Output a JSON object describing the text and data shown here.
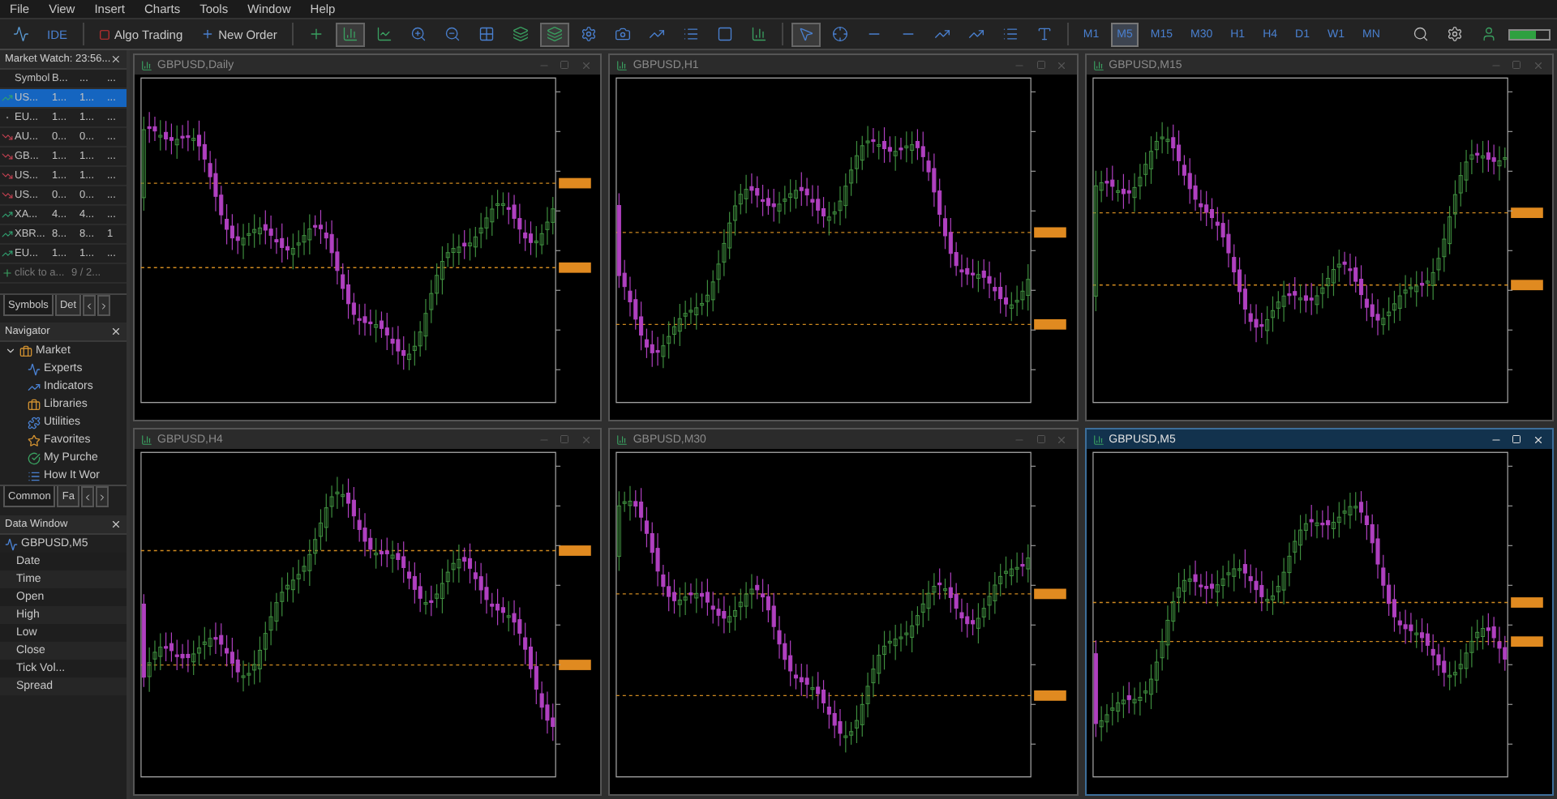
{
  "menu": [
    "File",
    "View",
    "Insert",
    "Charts",
    "Tools",
    "Window",
    "Help"
  ],
  "toolbar": {
    "ide": "IDE",
    "algo_trading": "Algo Trading",
    "new_order": "New Order",
    "timeframes": [
      {
        "label": "M1",
        "selected": false
      },
      {
        "label": "M5",
        "selected": true
      },
      {
        "label": "M15",
        "selected": false
      },
      {
        "label": "M30",
        "selected": false
      },
      {
        "label": "H1",
        "selected": false
      },
      {
        "label": "H4",
        "selected": false
      },
      {
        "label": "D1",
        "selected": false
      },
      {
        "label": "W1",
        "selected": false
      },
      {
        "label": "MN",
        "selected": false
      }
    ]
  },
  "market_watch": {
    "title": "Market Watch: 23:56...",
    "columns": [
      "Symbol",
      "B...",
      "...",
      "..."
    ],
    "rows": [
      {
        "kind": "up",
        "cells": [
          "US...",
          "1...",
          "1...",
          "..."
        ],
        "selected": true
      },
      {
        "kind": "flat",
        "cells": [
          "EU...",
          "1...",
          "1...",
          "..."
        ],
        "selected": false
      },
      {
        "kind": "down",
        "cells": [
          "AU...",
          "0...",
          "0...",
          "..."
        ],
        "selected": false
      },
      {
        "kind": "down",
        "cells": [
          "GB...",
          "1...",
          "1...",
          "..."
        ],
        "selected": false
      },
      {
        "kind": "down",
        "cells": [
          "US...",
          "1...",
          "1...",
          "..."
        ],
        "selected": false
      },
      {
        "kind": "down",
        "cells": [
          "US...",
          "0...",
          "0...",
          "..."
        ],
        "selected": false
      },
      {
        "kind": "up",
        "cells": [
          "XA...",
          "4...",
          "4...",
          "..."
        ],
        "selected": false
      },
      {
        "kind": "up",
        "cells": [
          "XBR...",
          "8...",
          "8...",
          "1"
        ],
        "selected": false
      },
      {
        "kind": "up",
        "cells": [
          "EU...",
          "1...",
          "1...",
          "..."
        ],
        "selected": false
      }
    ],
    "add_row": {
      "label": "click to a...",
      "count": "9 / 2..."
    },
    "tabs": [
      {
        "label": "Symbols",
        "selected": true
      },
      {
        "label": "Det",
        "selected": false
      }
    ]
  },
  "navigator": {
    "title": "Navigator",
    "tree": [
      {
        "label": "Market",
        "expanded": true,
        "children": [
          {
            "label": "Experts"
          },
          {
            "label": "Indicators"
          },
          {
            "label": "Libraries"
          },
          {
            "label": "Utilities"
          },
          {
            "label": "Favorites"
          },
          {
            "label": "My Purche"
          },
          {
            "label": "How It Wor"
          }
        ]
      }
    ],
    "tabs": [
      {
        "label": "Common",
        "selected": true
      },
      {
        "label": "Fa",
        "selected": false
      }
    ]
  },
  "data_window": {
    "title": "Data Window",
    "symbol": "GBPUSD,M5",
    "rows": [
      "Date",
      "Time",
      "Open",
      "High",
      "Low",
      "Close",
      "Tick Vol...",
      "Spread"
    ]
  },
  "charts": [
    {
      "title": "GBPUSD,Daily",
      "active": false
    },
    {
      "title": "GBPUSD,H1",
      "active": false
    },
    {
      "title": "GBPUSD,M15",
      "active": false
    },
    {
      "title": "GBPUSD,H4",
      "active": false
    },
    {
      "title": "GBPUSD,M30",
      "active": false
    },
    {
      "title": "GBPUSD,M5",
      "active": true
    }
  ]
}
